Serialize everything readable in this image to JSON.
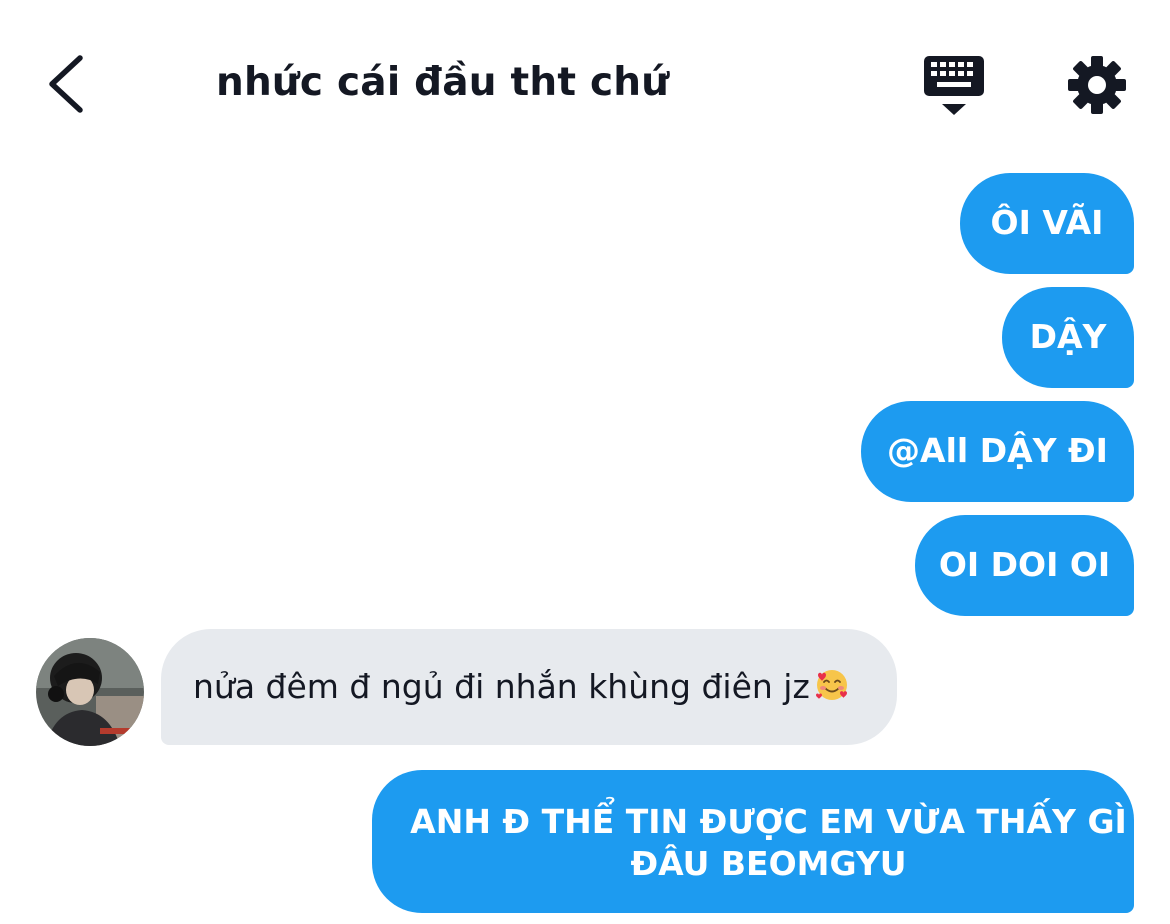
{
  "header": {
    "back_icon": "chevron-left-icon",
    "title": "nhức cái đầu tht chứ",
    "keyboard_icon": "keyboard-icon",
    "settings_icon": "gear-icon"
  },
  "messages": {
    "outgoing_1": "ÔI VÃI",
    "outgoing_2": "DẬY",
    "outgoing_3": "@All DẬY ĐI",
    "outgoing_4": "OI DOI OI",
    "incoming_1": {
      "text": "nửa đêm đ ngủ đi nhắn khùng điên jz",
      "emoji": "smiling-face-with-hearts"
    },
    "outgoing_5": {
      "line_1": "ANH Đ THỂ TIN ĐƯỢC EM VỪA THẤY GÌ",
      "line_2": "ĐÂU BEOMGYU"
    }
  },
  "colors": {
    "outgoing_bubble": "#1d9bf0",
    "incoming_bubble": "#e7eaee",
    "text_dark": "#141823",
    "background": "#ffffff"
  }
}
